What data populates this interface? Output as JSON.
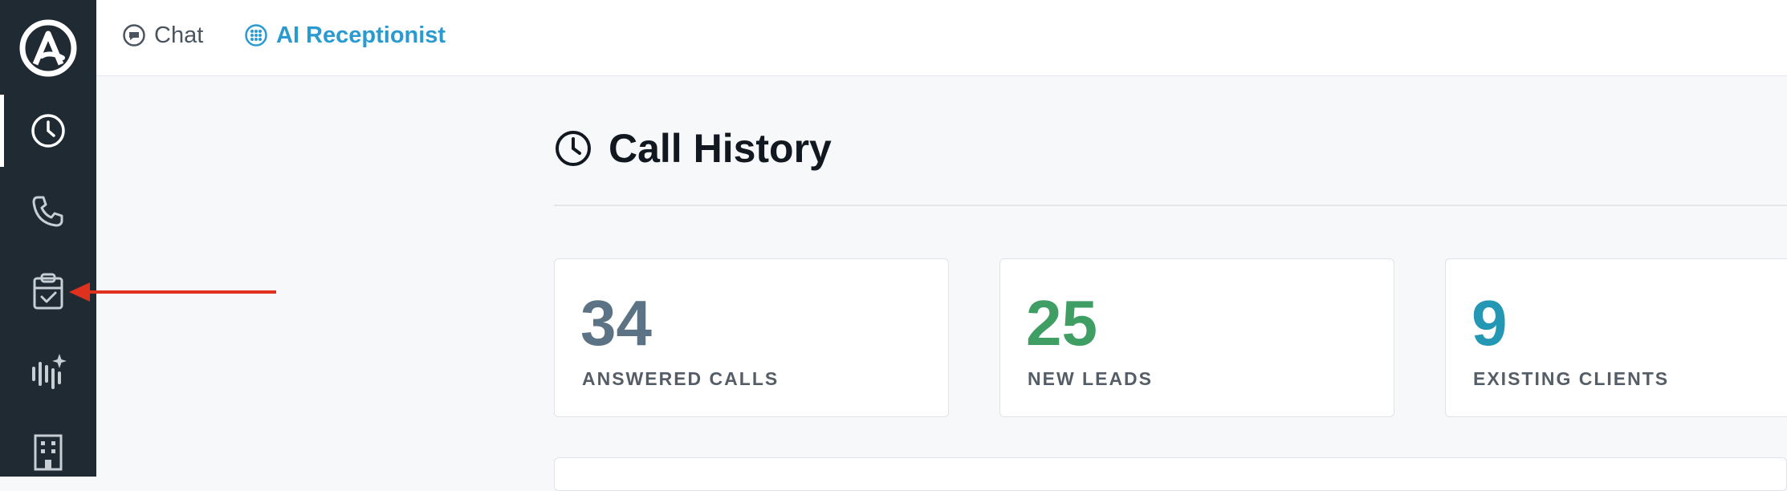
{
  "sidebar": {
    "logo": "app-logo",
    "items": [
      {
        "name": "call-history",
        "icon": "clock-icon",
        "active": true
      },
      {
        "name": "calls",
        "icon": "phone-icon",
        "active": false
      },
      {
        "name": "tasks",
        "icon": "clipboard-check-icon",
        "active": false
      },
      {
        "name": "ai-voice",
        "icon": "sparkle-waveform-icon",
        "active": false
      },
      {
        "name": "company",
        "icon": "building-icon",
        "active": false
      }
    ]
  },
  "topbar": {
    "tabs": [
      {
        "label": "Chat",
        "icon": "chat-bubble-icon"
      },
      {
        "label": "AI Receptionist",
        "icon": "dial-grid-icon"
      }
    ]
  },
  "main": {
    "title": "Call History",
    "stats": [
      {
        "value": "34",
        "label": "ANSWERED CALLS",
        "color": "#5b7384"
      },
      {
        "value": "25",
        "label": "NEW LEADS",
        "color": "#3f9e63"
      },
      {
        "value": "9",
        "label": "EXISTING CLIENTS",
        "color": "#2497b5"
      }
    ]
  },
  "colors": {
    "sidebar_bg": "#1f2a33",
    "accent": "#2a9bd0",
    "annotation": "#e0301e"
  }
}
